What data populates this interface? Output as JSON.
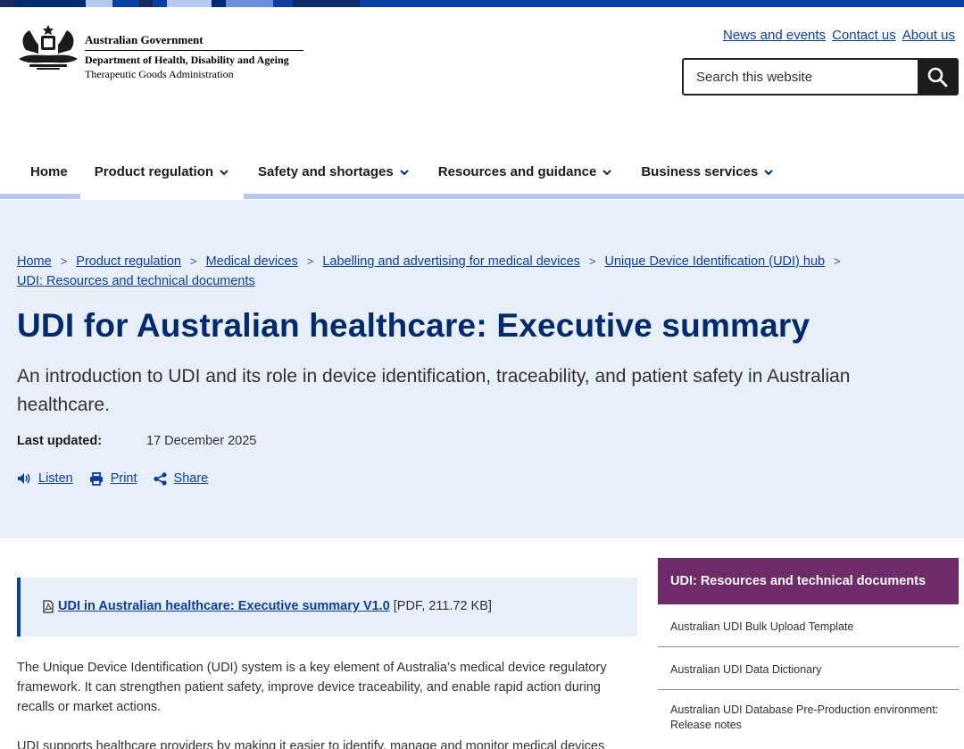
{
  "colors": {
    "brand_blue": "#0a3ea4",
    "title_navy": "#012b6e",
    "hero_bg": "#e9eff8",
    "nav_underline": "#b6c9ee",
    "sidebar_purple": "#6f2a6a"
  },
  "header": {
    "logo": {
      "icon": "coat-of-arms-icon",
      "gov": "Australian Government",
      "department": "Department of Health, Disability and Ageing",
      "agency": "Therapeutic Goods Administration"
    },
    "top_links": [
      "News and events",
      "Contact us",
      "About us"
    ],
    "search": {
      "placeholder": "Search this website",
      "icon": "search-icon"
    }
  },
  "nav": {
    "items": [
      {
        "label": "Home"
      },
      {
        "label": "Product regulation",
        "icon": "chevron-down-icon"
      },
      {
        "label": "Safety and shortages",
        "icon": "chevron-down-icon"
      },
      {
        "label": "Resources and guidance",
        "icon": "chevron-down-icon"
      },
      {
        "label": "Business services",
        "icon": "chevron-down-icon"
      }
    ]
  },
  "breadcrumb": [
    "Home",
    "Product regulation",
    "Medical devices",
    "Labelling and advertising for medical devices",
    "Unique Device Identification (UDI) hub",
    "UDI: Resources and technical documents"
  ],
  "page": {
    "title": "UDI for Australian healthcare: Executive summary",
    "subtitle": "An introduction to UDI and its role in device identification, traceability, and patient safety in Australian healthcare.",
    "updated_label": "Last updated:",
    "updated_value": "17 December 2025",
    "tools": [
      {
        "label": "Listen",
        "icon": "speaker-icon"
      },
      {
        "label": "Print",
        "icon": "printer-icon"
      },
      {
        "label": "Share",
        "icon": "share-icon"
      }
    ]
  },
  "content": {
    "download": {
      "icon": "pdf-file-icon",
      "link": "UDI in Australian healthcare: Executive summary V1.0",
      "meta": "[PDF, 211.72 KB]"
    },
    "paragraphs": [
      "The Unique Device Identification (UDI) system is a key element of Australia’s medical device regulatory framework. It can strengthen patient safety, improve device traceability, and enable rapid action during recalls or market actions.",
      "UDI supports healthcare providers by making it easier to identify, manage and monitor medical devices"
    ]
  },
  "sidebar": {
    "heading": "UDI: Resources and technical documents",
    "items": [
      "Australian UDI Bulk Upload Template",
      "Australian UDI Data Dictionary",
      "Australian UDI Database Pre-Production environment: Release notes"
    ]
  }
}
